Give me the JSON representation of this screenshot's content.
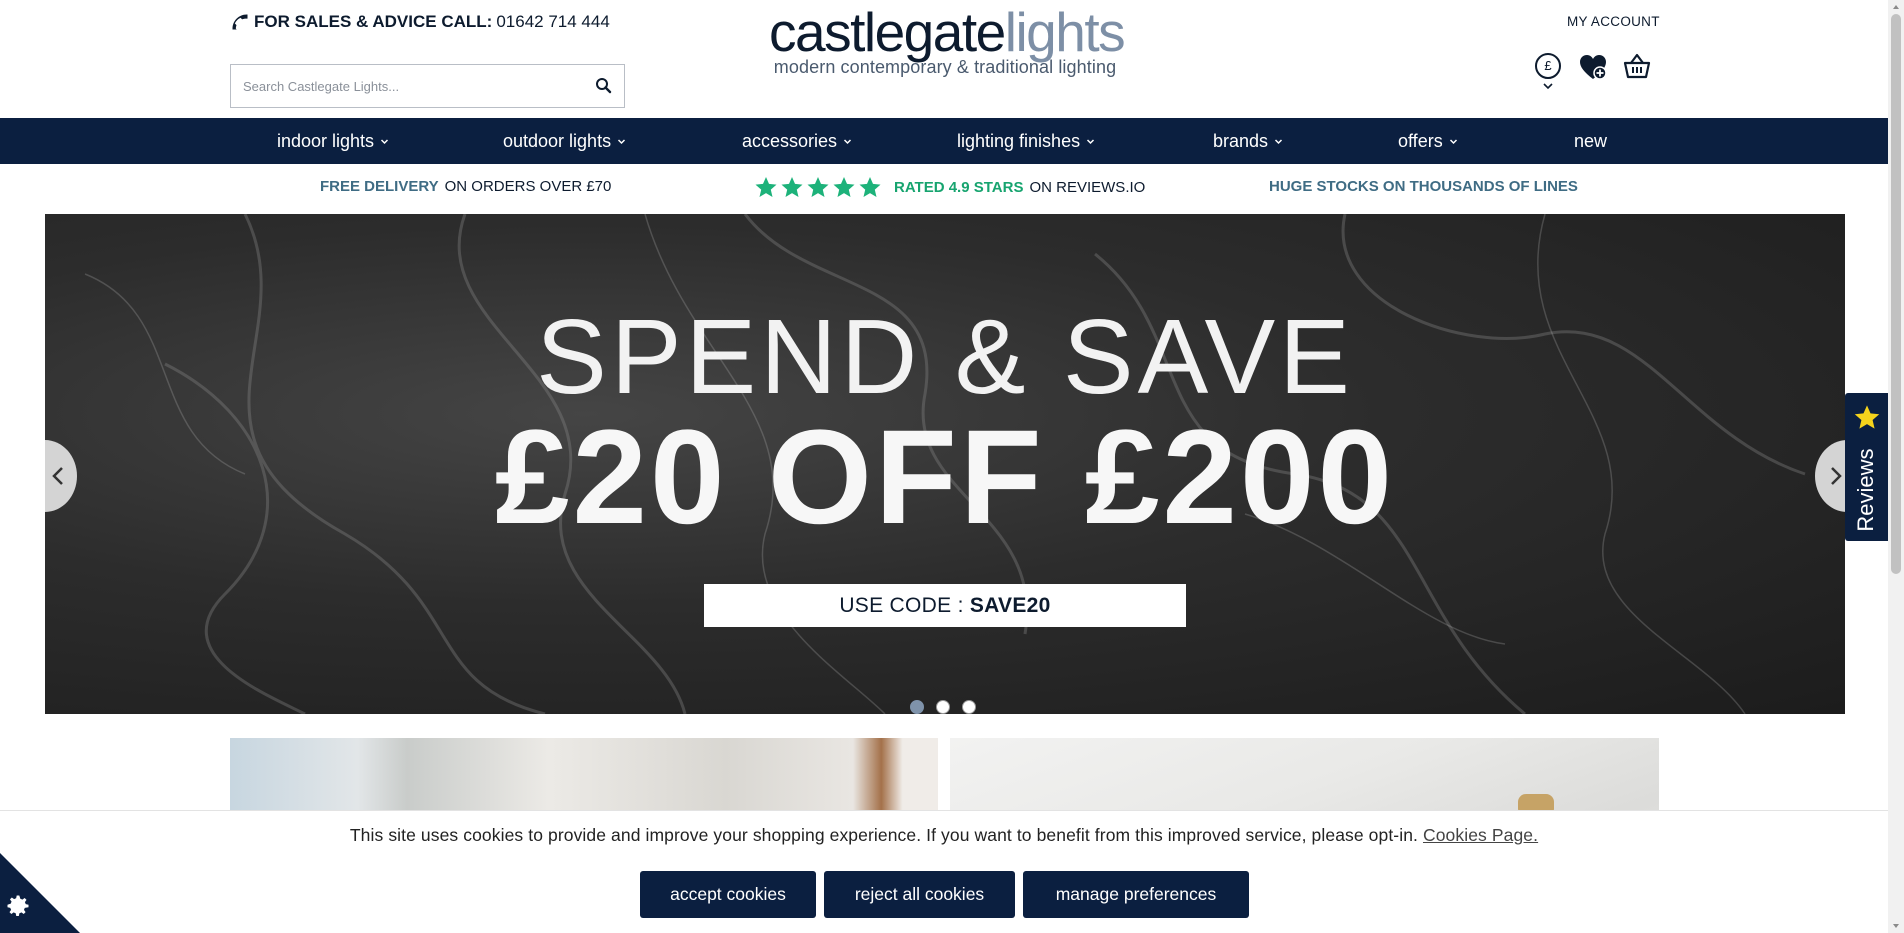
{
  "header": {
    "phone_label": "FOR SALES & ADVICE CALL:",
    "phone_number": "01642 714 444",
    "search_placeholder": "Search Castlegate Lights...",
    "logo_part1": "castlegate",
    "logo_part2": "lights",
    "logo_tagline": "modern contemporary & traditional lighting",
    "my_account": "MY ACCOUNT",
    "currency_symbol": "£"
  },
  "nav": {
    "items": [
      {
        "label": "indoor lights",
        "dropdown": true
      },
      {
        "label": "outdoor lights",
        "dropdown": true
      },
      {
        "label": "accessories",
        "dropdown": true
      },
      {
        "label": "lighting finishes",
        "dropdown": true
      },
      {
        "label": "brands",
        "dropdown": true
      },
      {
        "label": "offers",
        "dropdown": true
      },
      {
        "label": "new",
        "dropdown": false
      }
    ]
  },
  "usp": {
    "delivery_highlight": "FREE DELIVERY",
    "delivery_rest": "ON ORDERS OVER £70",
    "rating_highlight": "RATED 4.9 STARS",
    "rating_rest": "ON REVIEWS.IO",
    "stars": 5,
    "stocks": "HUGE STOCKS ON THOUSANDS OF LINES"
  },
  "hero": {
    "line1": "SPEND & SAVE",
    "line2": "£20 OFF £200",
    "code_prefix": "USE CODE : ",
    "code": "SAVE20",
    "slides": 3,
    "active_slide": 1
  },
  "reviews_tab": {
    "label": "Reviews"
  },
  "cookies": {
    "message": "This site uses cookies to provide and improve your shopping experience. If you want to benefit from this improved service, please opt-in.",
    "link": "Cookies Page.",
    "accept": "accept cookies",
    "reject": "reject all cookies",
    "manage": "manage preferences"
  },
  "colors": {
    "navy": "#0b1f40",
    "logo_grey": "#7d8fa6",
    "usp_teal": "#3f6c84",
    "rating_green": "#17a46f",
    "star_green": "#1db27a",
    "review_star_yellow": "#f5d31c"
  }
}
